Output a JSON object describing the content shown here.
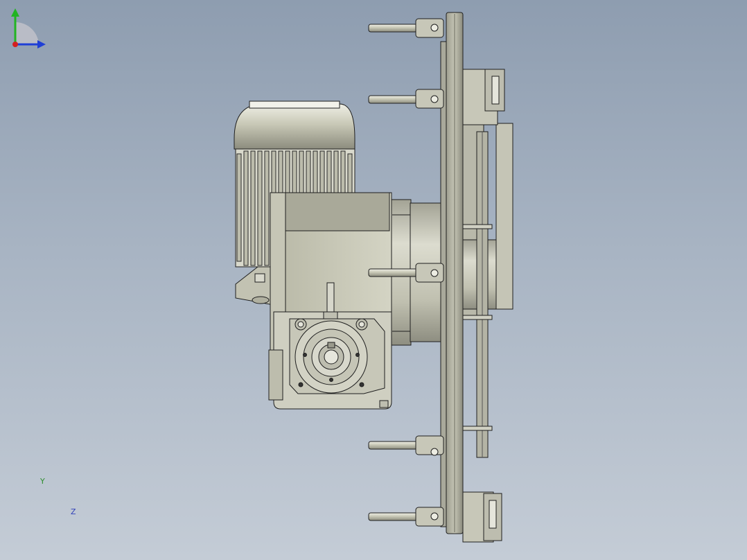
{
  "viewport": {
    "background_top": "#8e9db0",
    "background_bottom": "#c4ccd6",
    "model_color": "#c9c9b8",
    "edge_color": "#1e1e1e"
  },
  "model": {
    "parts": [
      "drive-motor",
      "gearbox-housing",
      "mounting-plate",
      "coupling-flange",
      "locking-pins",
      "drive-belt-guard"
    ]
  },
  "triad": {
    "y_label": "Y",
    "z_label": "Z",
    "y_color": "#22b422",
    "z_color": "#1f3fd6",
    "x_color": "#d42020",
    "icon": "coordinate-triad-icon"
  }
}
